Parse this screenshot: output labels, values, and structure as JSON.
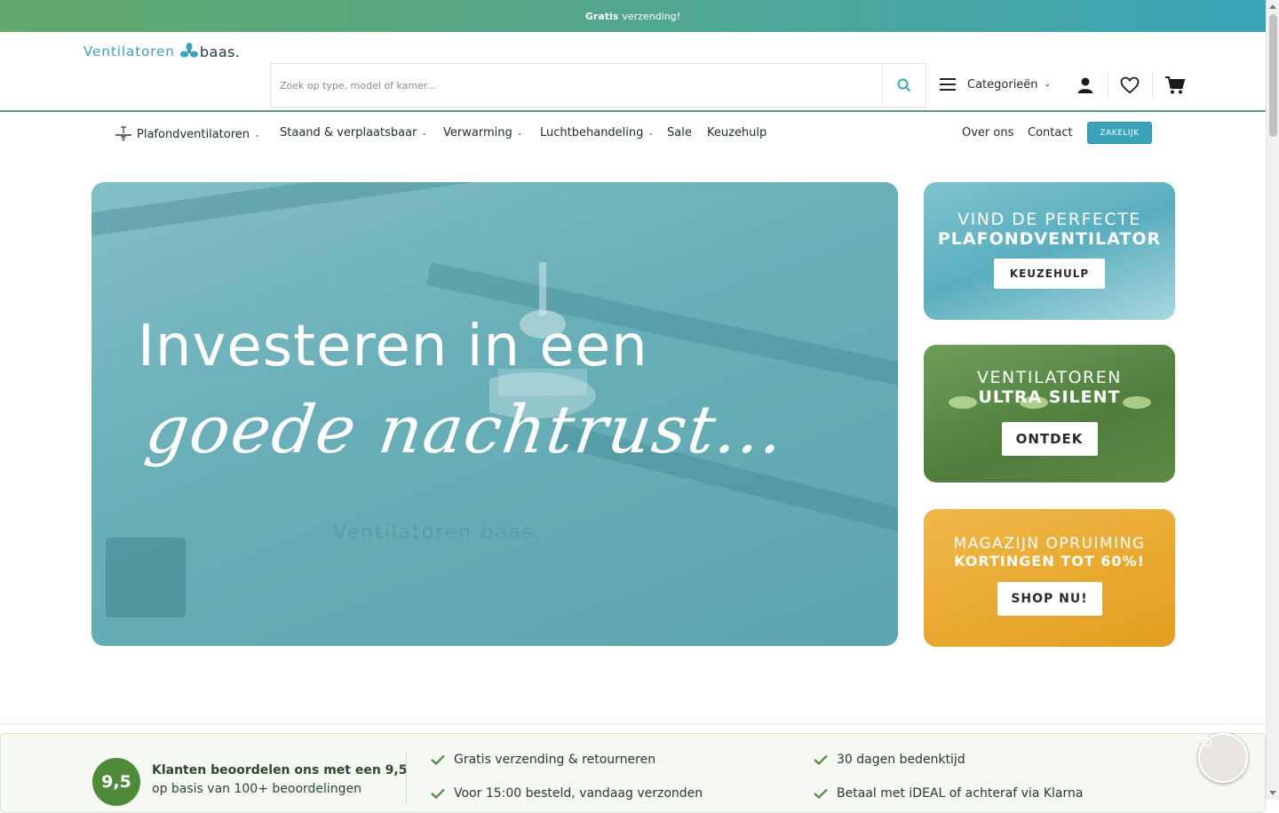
{
  "topbar": {
    "bold": "Gratis",
    "text": "verzending!"
  },
  "header": {
    "logo_word1": "Ventilatoren",
    "logo_word2": "baas.",
    "search_placeholder": "Zoek op type, model of kamer...",
    "categories_label": "Categorieën"
  },
  "nav": {
    "items": [
      "Plafondventilatoren",
      "Staand & verplaatsbaar",
      "Verwarming",
      "Luchtbehandeling",
      "Sale",
      "Keuzehulp"
    ],
    "right": [
      "Over ons",
      "Contact"
    ],
    "zakelijk": "ZAKELIJK"
  },
  "hero": {
    "line1": "Investeren in een",
    "line2": "goede nachtrust...",
    "watermark": "Ventilatoren baas."
  },
  "promos": [
    {
      "title1": "VIND DE PERFECTE",
      "title2": "PLAFONDVENTILATOR",
      "button": "KEUZEHULP"
    },
    {
      "title1": "VENTILATOREN",
      "title2": "ULTRA SILENT",
      "button": "ONTDEK"
    },
    {
      "title1": "MAGAZIJN OPRUIMING",
      "title2": "KORTINGEN TOT 60%!",
      "button": "SHOP NU!"
    }
  ],
  "trust": {
    "score": "9,5",
    "review_line1": "Klanten beoordelen ons met een 9,5",
    "review_line2": "op basis van 100+ beoordelingen",
    "usps": [
      "Gratis verzending & retourneren",
      "30 dagen bedenktijd",
      "Voor 15:00 besteld, vandaag verzonden",
      "Betaal met iDEAL of achteraf via Klarna"
    ]
  },
  "colors": {
    "accent": "#3aa3b9",
    "green": "#4e8a3a",
    "topbar_start": "#62a86a",
    "topbar_end": "#3aa4b8"
  }
}
